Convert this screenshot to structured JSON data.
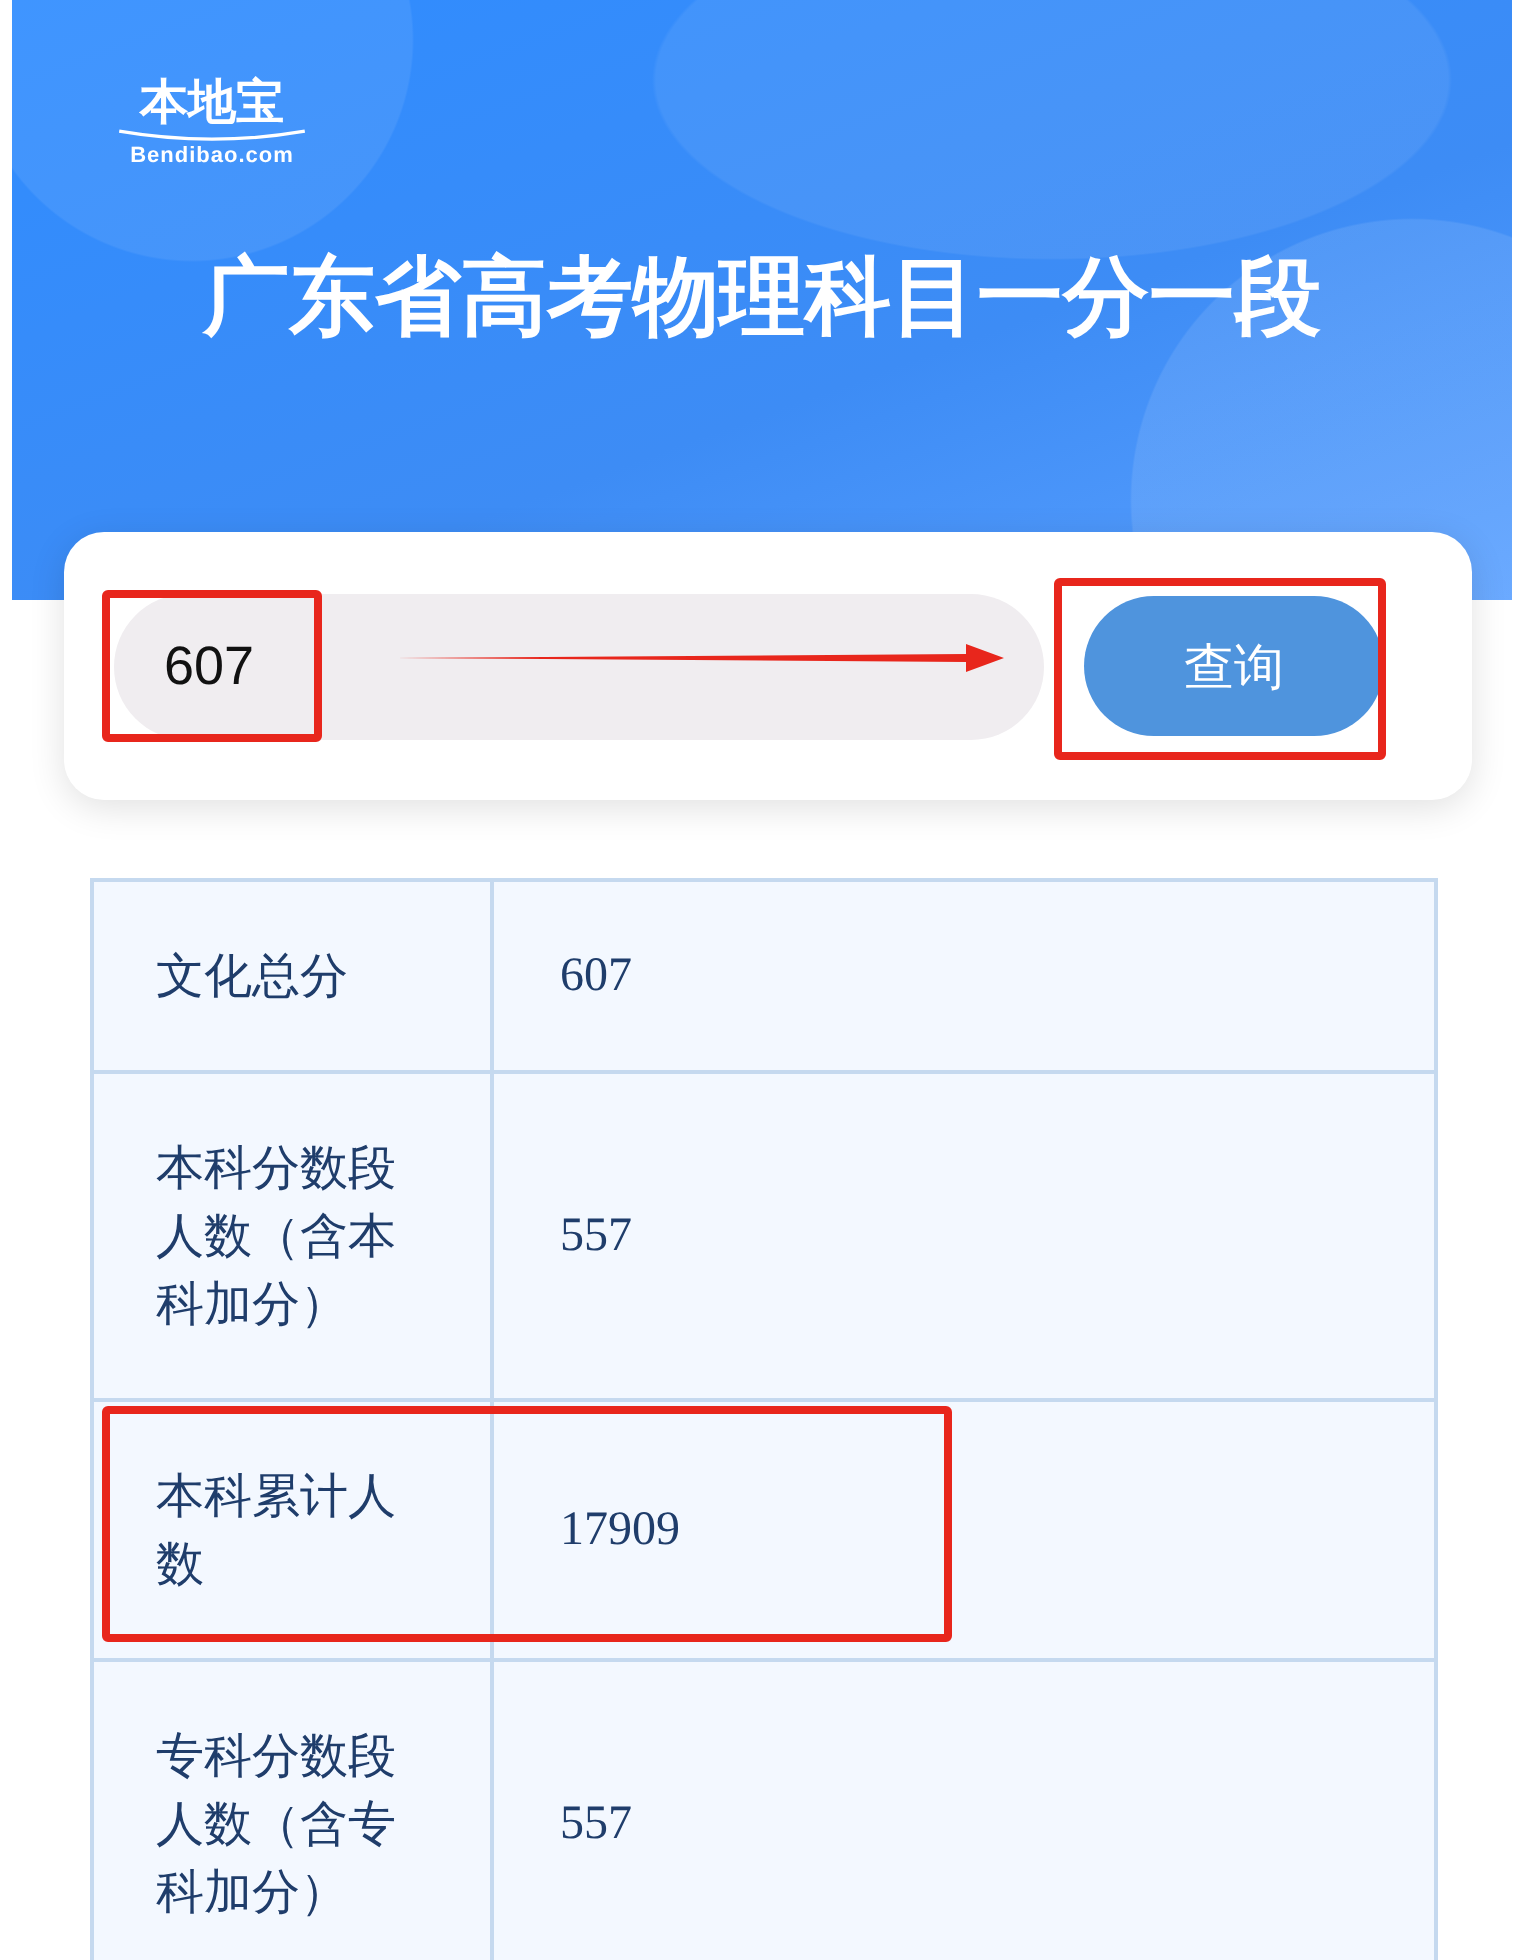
{
  "header": {
    "logo": {
      "name": "本地宝",
      "domain": "Bendibao.com"
    },
    "title": "广东省高考物理科目一分一段"
  },
  "search": {
    "value": "607",
    "highlighted": true,
    "arrow": true
  },
  "button": {
    "label": "查询",
    "highlighted": true
  },
  "table": {
    "rows": [
      {
        "label": "文化总分",
        "value": "607",
        "highlighted": false
      },
      {
        "label": "本科分数段人数（含本科加分）",
        "value": "557",
        "highlighted": false
      },
      {
        "label": "本科累计人数",
        "value": "17909",
        "highlighted": true
      },
      {
        "label": "专科分数段人数（含专科加分）",
        "value": "557",
        "highlighted": false
      }
    ]
  }
}
